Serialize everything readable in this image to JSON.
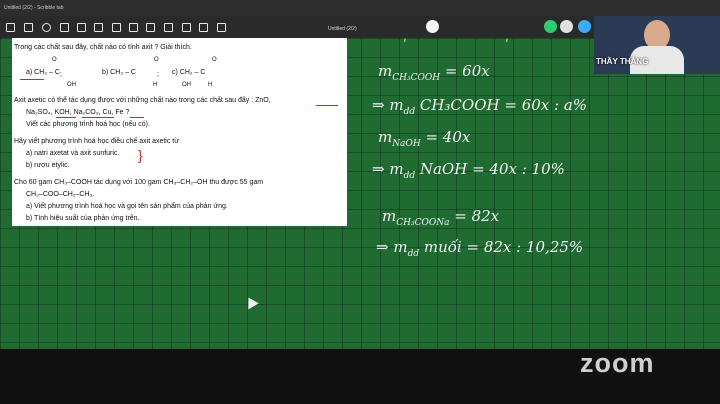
{
  "window": {
    "title": "Untitled (2/2) - Scribble tab"
  },
  "toolbar": {
    "doc_title": "Untitled (2/2)"
  },
  "worksheet": {
    "q4": "Trong các chất sau đây, chất nào có tính axit ? Giải thích.",
    "q4_a": "a) CH₃ – C",
    "q4_a_o": "O",
    "q4_a_oh": "OH",
    "q4_b": "b) CH₃ – C",
    "q4_b_o": "O",
    "q4_b_h": "H",
    "q4_c": "c) CH₂ – C",
    "q4_c_o": "O",
    "q4_c_oh": "OH",
    "q4_c_h": "H",
    "q4_sep": ";",
    "q5": "Axit axetic có thể tác dụng được với những chất nào trong các chất sau đây : ZnO,",
    "q5_l2": "Na₂SO₄, KOH, Na₂CO₃, Cu, Fe ?",
    "q5_l3": "Viết các phương trình hoá học (nếu có).",
    "q6": "Hãy viết phương trình hoá học điều chế axit axetic từ",
    "q6_a": "a) natri axetat và axit sunfuric.",
    "q6_b": "b) rượu etylic.",
    "q7": "Cho 60 gam CH₃–COOH tác dụng với 100 gam CH₃–CH₂–OH thu được 55 gam",
    "q7_l2": "CH₃–COO–CH₂–CH₃.",
    "q7_a": "a) Viết phương trình hoá học và gọi tên sản phẩm của phản ứng.",
    "q7_b": "b) Tính hiệu suất của phản ứng trên."
  },
  "board_notes": [
    {
      "text": "m",
      "sub": "CH₃COOH",
      "rest": " = 60x"
    },
    {
      "text": "⇒ m",
      "sub": "dd",
      "rest": " CH₃COOH = 60x : a%"
    },
    {
      "text": "m",
      "sub": "NaOH",
      "rest": " = 40x"
    },
    {
      "text": "⇒ m",
      "sub": "dd",
      "rest": " NaOH = 40x : 10%"
    },
    {
      "text": "m",
      "sub": "CH₃COONa",
      "rest": " = 82x"
    },
    {
      "text": "⇒ m",
      "sub": "dd",
      "rest": " muối = 82x : 10,25%"
    }
  ],
  "webcam": {
    "name": "THẦY THẮNG"
  },
  "footer": {
    "brand": "zoom"
  },
  "colors": {
    "board": "#1f6b32",
    "ink": "#c8262a"
  }
}
